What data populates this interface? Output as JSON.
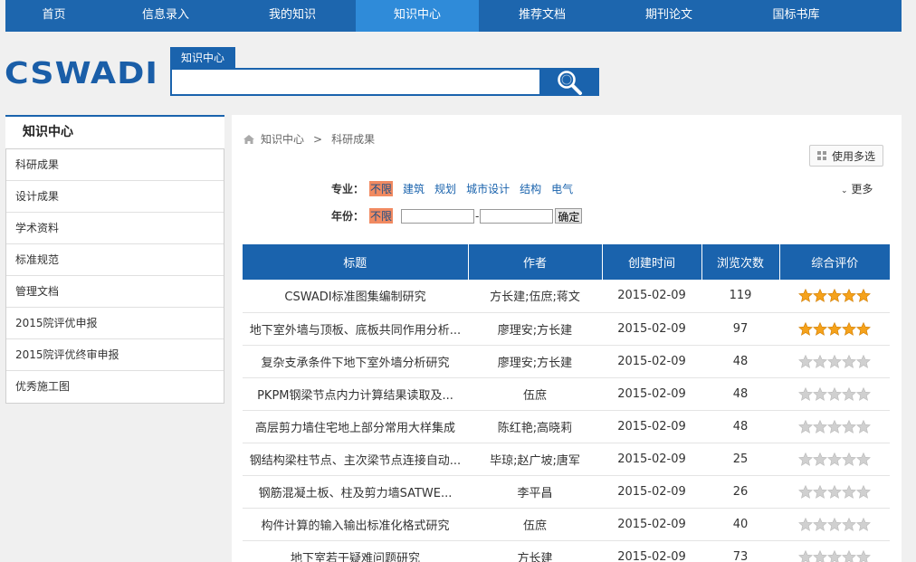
{
  "nav": {
    "items": [
      "首页",
      "信息录入",
      "我的知识",
      "知识中心",
      "推荐文档",
      "期刊论文",
      "国标书库"
    ],
    "active_index": 3
  },
  "logo": {
    "text": "CSWADI"
  },
  "search": {
    "tab_label": "知识中心",
    "value": "",
    "icon": "search-icon"
  },
  "sidebar": {
    "title": "知识中心",
    "items": [
      "科研成果",
      "设计成果",
      "学术资料",
      "标准规范",
      "管理文档",
      "2015院评优申报",
      "2015院评优终审申报",
      "优秀施工图"
    ]
  },
  "breadcrumb": {
    "home": "知识中心",
    "sep": ">",
    "current": "科研成果",
    "icon": "home-icon"
  },
  "multi_select": {
    "label": "使用多选",
    "icon": "grid-icon"
  },
  "more": {
    "label": "更多",
    "icon": "chevron-down-icon"
  },
  "filters": {
    "major": {
      "label": "专业：",
      "options": [
        "不限",
        "建筑",
        "规划",
        "城市设计",
        "结构",
        "电气"
      ],
      "selected_index": 0
    },
    "year": {
      "label": "年份：",
      "option": "不限",
      "from": "",
      "to": "",
      "dash": "-",
      "ok": "确定"
    }
  },
  "table": {
    "headers": [
      "标题",
      "作者",
      "创建时间",
      "浏览次数",
      "综合评价"
    ],
    "rows": [
      {
        "title": "CSWADI标准图集编制研究",
        "author": "方长建;伍庶;蒋文",
        "date": "2015-02-09",
        "views": "119",
        "rating": 5
      },
      {
        "title": "地下室外墙与顶板、底板共同作用分析...",
        "author": "廖理安;方长建",
        "date": "2015-02-09",
        "views": "97",
        "rating": 5
      },
      {
        "title": "复杂支承条件下地下室外墙分析研究",
        "author": "廖理安;方长建",
        "date": "2015-02-09",
        "views": "48",
        "rating": 0
      },
      {
        "title": "PKPM钢梁节点内力计算结果读取及...",
        "author": "伍庶",
        "date": "2015-02-09",
        "views": "48",
        "rating": 0
      },
      {
        "title": "高层剪力墙住宅地上部分常用大样集成",
        "author": "陈红艳;高晓莉",
        "date": "2015-02-09",
        "views": "48",
        "rating": 0
      },
      {
        "title": "钢结构梁柱节点、主次梁节点连接自动...",
        "author": "毕琼;赵广坡;唐军",
        "date": "2015-02-09",
        "views": "25",
        "rating": 0
      },
      {
        "title": "钢筋混凝土板、柱及剪力墙SATWE...",
        "author": "李平昌",
        "date": "2015-02-09",
        "views": "26",
        "rating": 0
      },
      {
        "title": "构件计算的输入输出标准化格式研究",
        "author": "伍庶",
        "date": "2015-02-09",
        "views": "40",
        "rating": 0
      },
      {
        "title": "地下室若干疑难问题研究",
        "author": "方长建",
        "date": "2015-02-09",
        "views": "73",
        "rating": 0
      }
    ]
  },
  "colors": {
    "nav": "#1d66ae",
    "nav_active": "#2f8bd9",
    "accent": "#1a63ad",
    "selected_filter": "#f18a61",
    "star_on": "#f5a21b",
    "star_off": "#d0d0d0"
  }
}
